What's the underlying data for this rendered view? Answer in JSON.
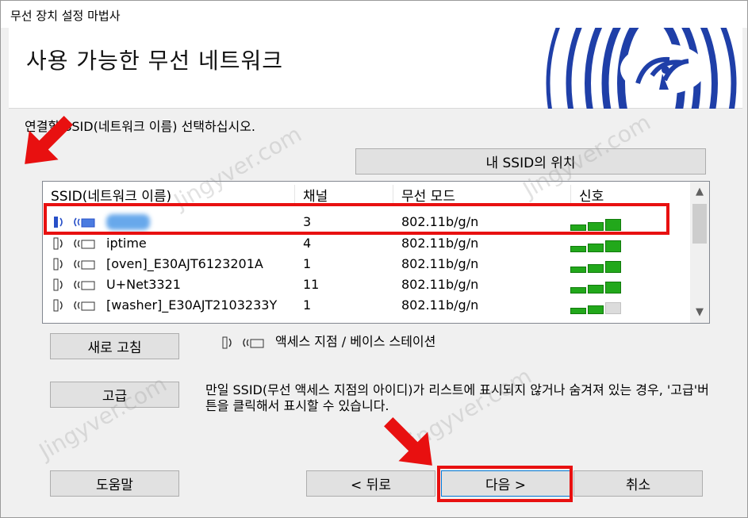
{
  "window": {
    "title": "무선 장치 설정 마법사",
    "header_title": "사용 가능한 무선 네트워크"
  },
  "instruction": "연결할 SSID(네트워크 이름) 선택하십시오.",
  "buttons": {
    "ssid_location": "내 SSID의 위치",
    "refresh": "새로 고침",
    "advanced": "고급",
    "help": "도움말",
    "back": "< 뒤로",
    "next": "다음 >",
    "cancel": "취소"
  },
  "list": {
    "columns": [
      "SSID(네트워크 이름)",
      "채널",
      "무선 모드",
      "신호"
    ],
    "rows": [
      {
        "ssid": "",
        "channel": "3",
        "mode": "802.11b/g/n",
        "signal_bars": 3,
        "selected": true
      },
      {
        "ssid": "iptime",
        "channel": "4",
        "mode": "802.11b/g/n",
        "signal_bars": 3
      },
      {
        "ssid": "[oven]_E30AJT6123201A",
        "channel": "1",
        "mode": "802.11b/g/n",
        "signal_bars": 3
      },
      {
        "ssid": "U+Net3321",
        "channel": "11",
        "mode": "802.11b/g/n",
        "signal_bars": 3
      },
      {
        "ssid": "[washer]_E30AJT2103233Y",
        "channel": "1",
        "mode": "802.11b/g/n",
        "signal_bars": 2
      }
    ]
  },
  "legend": {
    "text": "액세스 지점 / 베이스 스테이션"
  },
  "advanced_note": "만일 SSID(무선 액세스 지점의 아이디)가 리스트에 표시되지 않거나 숨겨져 있는 경우, '고급'버튼을 클릭해서 표시할 수 있습니다.",
  "watermark": "Jingyver.com",
  "colors": {
    "signal_on": "#22a81b",
    "signal_off": "#dcdcdc",
    "highlight": "#e81010",
    "logo_blue": "#1f3fa8"
  },
  "icons": {
    "access_point": "access-point-icon",
    "logo": "wireless-logo-icon"
  }
}
